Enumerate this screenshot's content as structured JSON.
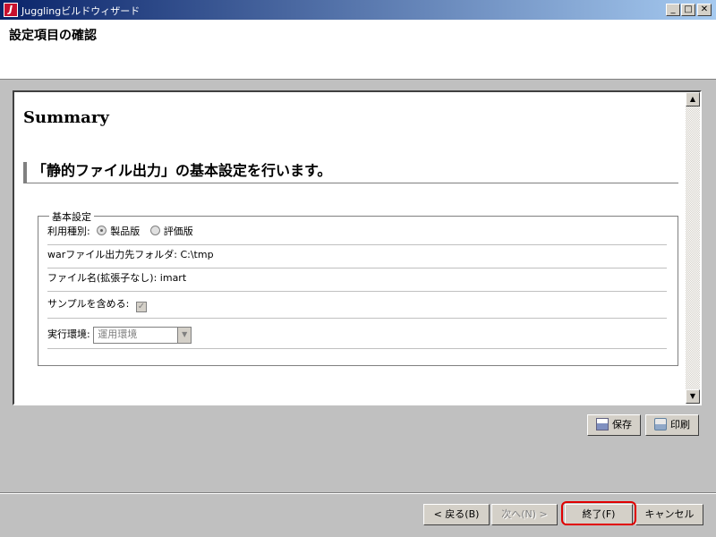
{
  "window": {
    "title": "Jugglingビルドウィザード",
    "controls": {
      "minimize": "_",
      "maximize": "□",
      "close": "✕"
    }
  },
  "header": {
    "title": "設定項目の確認"
  },
  "content": {
    "summary_heading": "Summary",
    "section_heading": "「静的ファイル出力」の基本設定を行います。",
    "fieldset": {
      "legend": "基本設定",
      "license_label": "利用種別:",
      "license_options": [
        "製品版",
        "評価版"
      ],
      "license_selected": "製品版",
      "war_output_label": "warファイル出力先フォルダ:",
      "war_output_value": "C:\\tmp",
      "filename_label": "ファイル名(拡張子なし):",
      "filename_value": "imart",
      "include_sample_label": "サンプルを含める:",
      "include_sample_checked": true,
      "runtime_label": "実行環境:",
      "runtime_value": "運用環境"
    }
  },
  "actions": {
    "save": "保存",
    "print": "印刷"
  },
  "footer": {
    "back": "< 戻る(B)",
    "next": "次へ(N) >",
    "finish": "終了(F)",
    "cancel": "キャンセル"
  },
  "colors": {
    "highlight": "#e00000",
    "titlebar_start": "#0a246a",
    "titlebar_end": "#a6caf0"
  }
}
